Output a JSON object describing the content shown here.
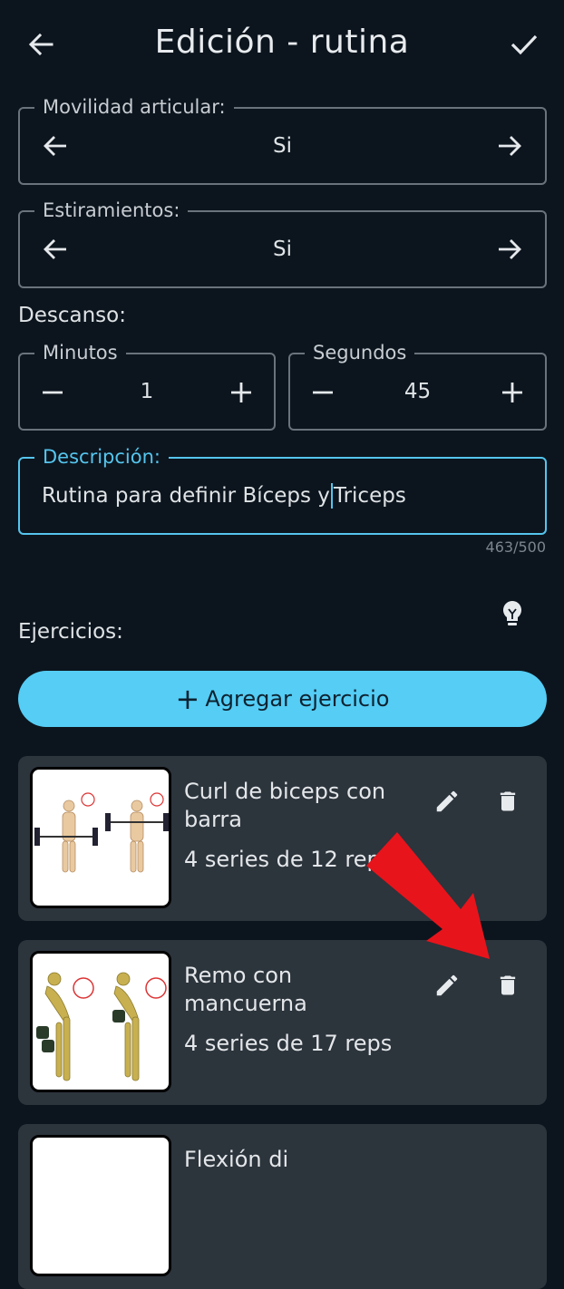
{
  "header": {
    "title": "Edición - rutina"
  },
  "movilidad": {
    "label": "Movilidad articular:",
    "value": "Si"
  },
  "estiramientos": {
    "label": "Estiramientos:",
    "value": "Si"
  },
  "descanso": {
    "label": "Descanso:",
    "minutos": {
      "label": "Minutos",
      "value": "1"
    },
    "segundos": {
      "label": "Segundos",
      "value": "45"
    }
  },
  "descripcion": {
    "label": "Descripción:",
    "text_before_cursor": "Rutina para definir Bíceps y",
    "text_after_cursor": "Triceps",
    "counter": "463/500"
  },
  "ejercicios": {
    "label": "Ejercicios:",
    "add_button": "Agregar ejercicio",
    "items": [
      {
        "name": "Curl de biceps con barra",
        "sets": "4 series de 12 reps"
      },
      {
        "name": "Remo con mancuerna",
        "sets": "4 series de 17 reps"
      },
      {
        "name": "Flexión di",
        "sets": ""
      }
    ]
  },
  "colors": {
    "background": "#0c151e",
    "accent": "#55cdf5",
    "card": "#2c343c",
    "annotation_arrow": "#e8141b"
  },
  "icons": [
    "back-arrow-icon",
    "check-icon",
    "arrow-left-icon",
    "arrow-right-icon",
    "minus-icon",
    "plus-icon",
    "lightbulb-icon",
    "pencil-icon",
    "trash-icon"
  ]
}
